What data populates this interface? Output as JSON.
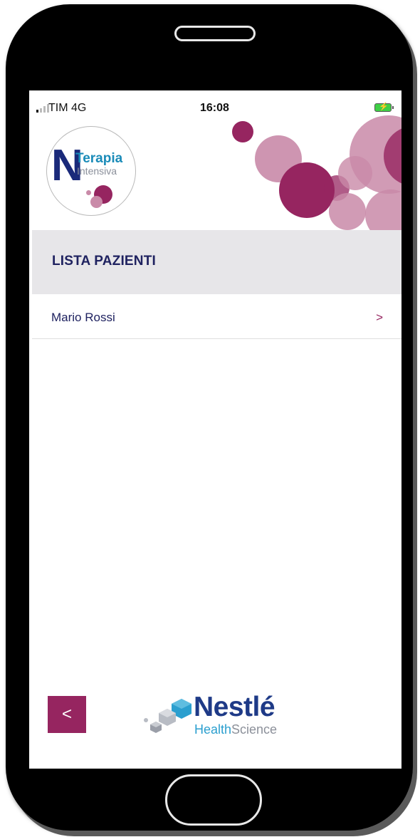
{
  "status_bar": {
    "carrier": "TIM  4G",
    "time": "16:08"
  },
  "logo": {
    "letter": "N",
    "line1": "Terapia",
    "line2": "Intensiva"
  },
  "section": {
    "title": "LISTA PAZIENTI"
  },
  "patients": [
    {
      "name": "Mario Rossi",
      "chevron": ">"
    }
  ],
  "footer": {
    "back_label": "<",
    "brand_name": "Nestlé",
    "brand_sub_health": "Health",
    "brand_sub_science": "Science"
  },
  "colors": {
    "accent": "#962560",
    "accent_light": "#c98aa8",
    "title_navy": "#1f2260",
    "section_bg": "#e7e6e9"
  },
  "icons": {
    "signal": "signal-bars-icon",
    "battery": "battery-charging-icon",
    "chevron": "chevron-right-icon",
    "back": "chevron-left-icon"
  }
}
